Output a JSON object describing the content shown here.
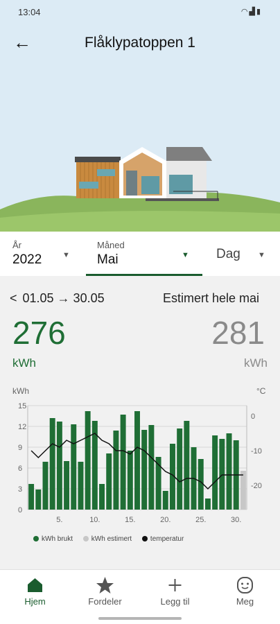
{
  "status": {
    "time": "13:04"
  },
  "header": {
    "title": "Flåklypatoppen 1"
  },
  "period": {
    "year_caption": "År",
    "year_value": "2022",
    "month_caption": "Måned",
    "month_value": "Mai",
    "day_value": "Dag"
  },
  "summary": {
    "range": "01.05 → 30.05",
    "estimate_label": "Estimert hele mai",
    "used_value": "276",
    "used_unit": "kWh",
    "estimated_value": "281",
    "estimated_unit": "kWh"
  },
  "legend": {
    "used": "kWh brukt",
    "estimated": "kWh estimert",
    "temperature": "temperatur"
  },
  "nav": {
    "home": "Hjem",
    "benefits": "Fordeler",
    "add": "Legg til",
    "me": "Meg"
  },
  "colors": {
    "accent": "#1a5c2e",
    "bar_used": "#1f6e35",
    "bar_estimated": "#c7c7c7",
    "temperature": "#111111"
  },
  "chart_data": {
    "type": "bar",
    "xlabel": "",
    "ylabel": "kWh",
    "y2label": "°C",
    "ylim": [
      0,
      15
    ],
    "y2lim": [
      -27,
      3
    ],
    "yticks": [
      0,
      3,
      6,
      9,
      12,
      15
    ],
    "y2ticks": [
      0,
      -10,
      -20
    ],
    "xticks": [
      5,
      10,
      15,
      20,
      25,
      30
    ],
    "xticklabels": [
      "5.",
      "10.",
      "15.",
      "20.",
      "25.",
      "30."
    ],
    "days": [
      1,
      2,
      3,
      4,
      5,
      6,
      7,
      8,
      9,
      10,
      11,
      12,
      13,
      14,
      15,
      16,
      17,
      18,
      19,
      20,
      21,
      22,
      23,
      24,
      25,
      26,
      27,
      28,
      29,
      30,
      31
    ],
    "series": [
      {
        "name": "kWh brukt",
        "values": [
          3.7,
          2.9,
          6.9,
          13.2,
          12.7,
          7.0,
          12.3,
          6.9,
          14.2,
          12.8,
          3.7,
          8.1,
          11.4,
          13.7,
          8.5,
          14.2,
          11.5,
          12.2,
          7.6,
          2.7,
          9.5,
          11.7,
          12.8,
          9.0,
          7.3,
          1.6,
          10.7,
          10.2,
          11.0,
          10.0,
          0
        ]
      },
      {
        "name": "kWh estimert",
        "values": [
          0,
          0,
          0,
          0,
          0,
          0,
          0,
          0,
          0,
          0,
          0,
          0,
          0,
          0,
          0,
          0,
          0,
          0,
          0,
          0,
          0,
          0,
          0,
          0,
          0,
          0,
          0,
          0,
          0,
          0,
          5.6
        ]
      },
      {
        "name": "temperatur",
        "values": [
          -10,
          -12,
          -10,
          -8,
          -9,
          -7,
          -8,
          -7,
          -6,
          -5,
          -7,
          -8,
          -10,
          -10,
          -11,
          -9,
          -10,
          -12,
          -14,
          -16,
          -17,
          -19,
          -18,
          -18,
          -19,
          -21,
          -19,
          -17,
          -17,
          -17,
          -17
        ]
      }
    ]
  }
}
